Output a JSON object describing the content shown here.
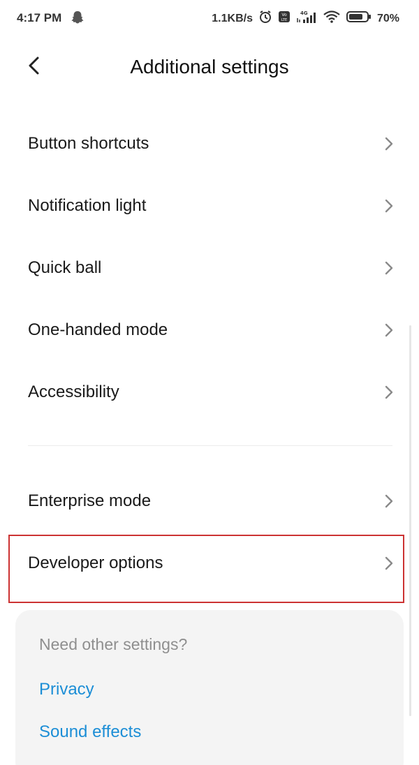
{
  "status_bar": {
    "time": "4:17 PM",
    "speed": "1.1KB/s",
    "network": "4G",
    "battery": "70%"
  },
  "header": {
    "title": "Additional settings"
  },
  "settings_group_1": [
    {
      "label": "Button shortcuts"
    },
    {
      "label": "Notification light"
    },
    {
      "label": "Quick ball"
    },
    {
      "label": "One-handed mode"
    },
    {
      "label": "Accessibility"
    }
  ],
  "settings_group_2": [
    {
      "label": "Enterprise mode"
    },
    {
      "label": "Developer options"
    }
  ],
  "suggestions": {
    "heading": "Need other settings?",
    "links": [
      {
        "label": "Privacy"
      },
      {
        "label": "Sound effects"
      }
    ]
  },
  "colors": {
    "link": "#1c8ed6",
    "highlight": "#cc3333",
    "card_bg": "#f4f4f4"
  },
  "icons": [
    "snapchat-icon",
    "alarm-icon",
    "volte-icon",
    "signal-icon",
    "wifi-icon",
    "battery-icon",
    "back-arrow-icon",
    "chevron-right-icon"
  ]
}
